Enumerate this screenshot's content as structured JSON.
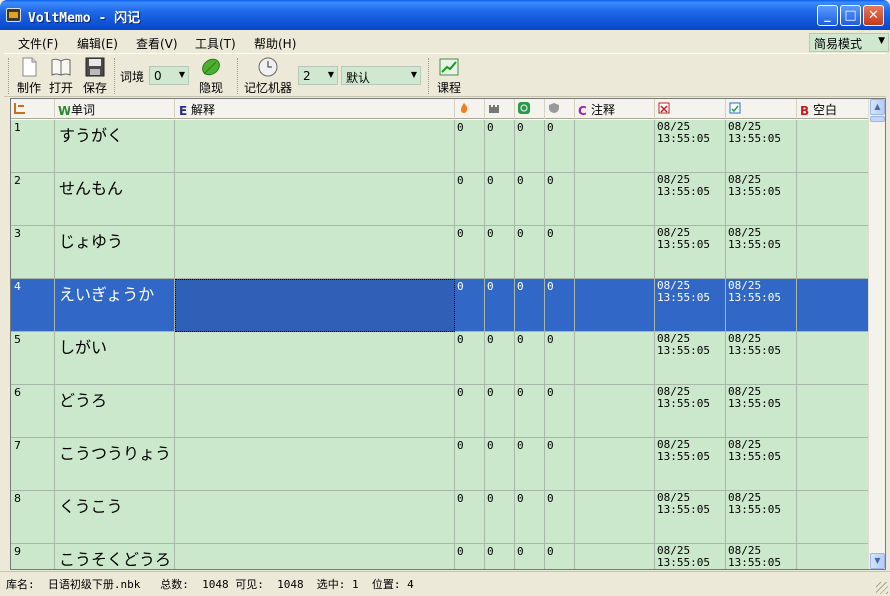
{
  "window": {
    "title": "VoltMemo - 闪记"
  },
  "menu": {
    "items": [
      "文件(F)",
      "编辑(E)",
      "查看(V)",
      "工具(T)",
      "帮助(H)"
    ],
    "mode": "简易模式"
  },
  "toolbar": {
    "make": "制作",
    "open": "打开",
    "save": "保存",
    "context_label": "词境",
    "context_value": "0",
    "hide": "隐现",
    "memory": "记忆机器",
    "memory_value": "2",
    "memory_mode": "默认",
    "course": "课程"
  },
  "grid": {
    "headers": {
      "word": "单词",
      "definition": "解释",
      "note": "注释",
      "blank": "空白"
    },
    "rows": [
      {
        "num": "1",
        "word": "すうがく",
        "a": "0",
        "b": "0",
        "c": "0",
        "d": "0",
        "date1": "08/25",
        "time1": "13:55:05",
        "date2": "08/25",
        "time2": "13:55:05"
      },
      {
        "num": "2",
        "word": "せんもん",
        "a": "0",
        "b": "0",
        "c": "0",
        "d": "0",
        "date1": "08/25",
        "time1": "13:55:05",
        "date2": "08/25",
        "time2": "13:55:05"
      },
      {
        "num": "3",
        "word": "じょゆう",
        "a": "0",
        "b": "0",
        "c": "0",
        "d": "0",
        "date1": "08/25",
        "time1": "13:55:05",
        "date2": "08/25",
        "time2": "13:55:05"
      },
      {
        "num": "4",
        "word": "えいぎょうか",
        "a": "0",
        "b": "0",
        "c": "0",
        "d": "0",
        "date1": "08/25",
        "time1": "13:55:05",
        "date2": "08/25",
        "time2": "13:55:05"
      },
      {
        "num": "5",
        "word": "しがい",
        "a": "0",
        "b": "0",
        "c": "0",
        "d": "0",
        "date1": "08/25",
        "time1": "13:55:05",
        "date2": "08/25",
        "time2": "13:55:05"
      },
      {
        "num": "6",
        "word": "どうろ",
        "a": "0",
        "b": "0",
        "c": "0",
        "d": "0",
        "date1": "08/25",
        "time1": "13:55:05",
        "date2": "08/25",
        "time2": "13:55:05"
      },
      {
        "num": "7",
        "word": "こうつうりょう",
        "a": "0",
        "b": "0",
        "c": "0",
        "d": "0",
        "date1": "08/25",
        "time1": "13:55:05",
        "date2": "08/25",
        "time2": "13:55:05"
      },
      {
        "num": "8",
        "word": "くうこう",
        "a": "0",
        "b": "0",
        "c": "0",
        "d": "0",
        "date1": "08/25",
        "time1": "13:55:05",
        "date2": "08/25",
        "time2": "13:55:05"
      },
      {
        "num": "9",
        "word": "こうそくどうろ",
        "a": "0",
        "b": "0",
        "c": "0",
        "d": "0",
        "date1": "08/25",
        "time1": "13:55:05",
        "date2": "08/25",
        "time2": "13:55:05"
      }
    ],
    "selected_row": 3
  },
  "status": {
    "text": "库名:  日语初级下册.nbk   总数:  1048 可见:  1048  选中: 1  位置: 4"
  },
  "colors": {
    "row_bg": "#cce8cc",
    "selected_bg": "#3168c8",
    "titlebar": "#0b4fd1"
  }
}
